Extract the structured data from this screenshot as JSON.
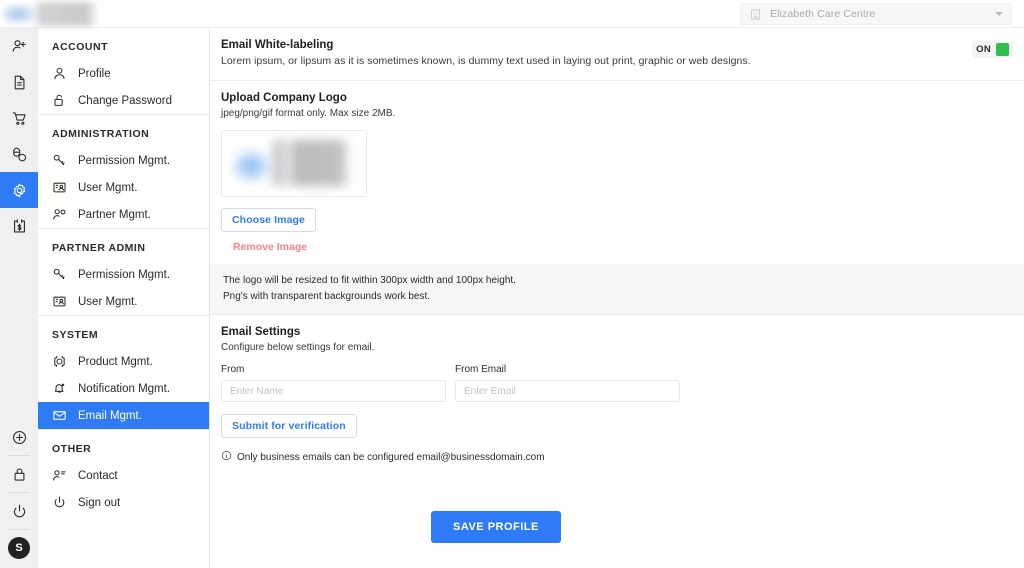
{
  "topbar": {
    "brand_logo_alt": "company-logo",
    "org_selector": {
      "icon": "building-icon",
      "value": "Elizabeth Care Centre",
      "caret": "chevron-down-icon"
    }
  },
  "rail": {
    "top_items": [
      {
        "name": "add-user-icon",
        "active": false
      },
      {
        "name": "document-icon",
        "active": false
      },
      {
        "name": "cart-icon",
        "active": false
      },
      {
        "name": "medication-icon",
        "active": false
      },
      {
        "name": "gear-icon",
        "active": true
      },
      {
        "name": "calendar-dollar-icon",
        "active": false
      }
    ],
    "bottom_items": [
      {
        "name": "plus-circle-icon"
      },
      {
        "name": "lock-icon"
      },
      {
        "name": "power-icon"
      }
    ],
    "avatar_initial": "S"
  },
  "sidebar": {
    "groups": [
      {
        "title": "ACCOUNT",
        "items": [
          {
            "label": "Profile",
            "icon": "user-icon",
            "active": false
          },
          {
            "label": "Change Password",
            "icon": "unlock-icon",
            "active": false
          }
        ]
      },
      {
        "title": "ADMINISTRATION",
        "items": [
          {
            "label": "Permission Mgmt.",
            "icon": "key-icon",
            "active": false
          },
          {
            "label": "User Mgmt.",
            "icon": "id-card-icon",
            "active": false
          },
          {
            "label": "Partner Mgmt.",
            "icon": "partner-icon",
            "active": false
          }
        ]
      },
      {
        "title": "PARTNER ADMIN",
        "items": [
          {
            "label": "Permission Mgmt.",
            "icon": "key-icon",
            "active": false
          },
          {
            "label": "User Mgmt.",
            "icon": "id-card-icon",
            "active": false
          }
        ]
      },
      {
        "title": "SYSTEM",
        "items": [
          {
            "label": "Product Mgmt.",
            "icon": "product-icon",
            "active": false
          },
          {
            "label": "Notification Mgmt.",
            "icon": "bell-icon",
            "active": false
          },
          {
            "label": "Email Mgmt.",
            "icon": "envelope-icon",
            "active": true
          }
        ]
      },
      {
        "title": "OTHER",
        "items": [
          {
            "label": "Contact",
            "icon": "contact-icon",
            "active": false
          },
          {
            "label": "Sign out",
            "icon": "power-icon",
            "active": false
          }
        ]
      }
    ]
  },
  "main": {
    "white_labeling": {
      "title": "Email White-labeling",
      "description": "Lorem ipsum, or lipsum as it is sometimes known, is dummy text used in laying out print, graphic or web designs.",
      "toggle": {
        "label": "ON",
        "state": "on",
        "color": "#2ec04e"
      }
    },
    "upload_logo": {
      "title": "Upload Company Logo",
      "subtitle": "jpeg/png/gif format only. Max size 2MB.",
      "preview_alt": "company-logo-preview",
      "choose_button": "Choose Image",
      "remove_link": "Remove Image",
      "note_line_1": "The logo will be resized to fit within 300px width and 100px height.",
      "note_line_2": "Png's with transparent backgrounds work best."
    },
    "email_settings": {
      "title": "Email Settings",
      "subtitle": "Configure below settings for email.",
      "fields": [
        {
          "label": "From",
          "value": "",
          "placeholder": "Enter Name"
        },
        {
          "label": "From Email",
          "value": "",
          "placeholder": "Enter Email"
        }
      ],
      "submit_button": "Submit for verification",
      "hint_icon": "info-icon",
      "hint_text": "Only business emails can be configured email@businessdomain.com"
    },
    "save_button": "SAVE PROFILE"
  },
  "colors": {
    "accent": "#2f7bf6",
    "danger": "#fb8184",
    "success": "#2ec04e",
    "rail_bg": "#f0f0f1"
  }
}
